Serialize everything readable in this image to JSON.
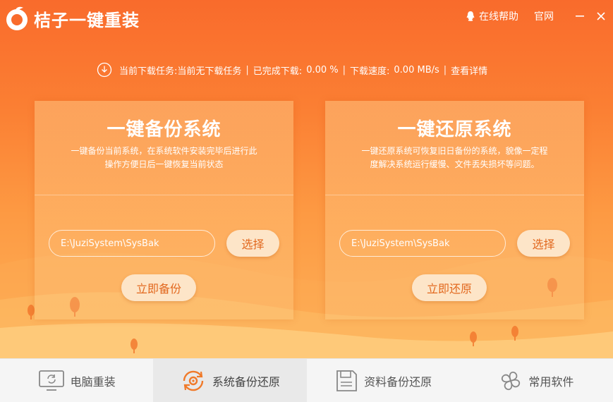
{
  "app": {
    "title": "桔子一键重装",
    "help_label": "在线帮助",
    "site_label": "官网",
    "minimize_icon": "minimize-icon",
    "close_icon": "close-icon"
  },
  "download": {
    "task_label": "当前下载任务:",
    "task_value": "当前无下载任务",
    "completed_label": "已完成下载:",
    "completed_value": "0.00 %",
    "speed_label": "下载速度:",
    "speed_value": "0.00 MB/s",
    "details_label": "查看详情",
    "icon": "download-icon"
  },
  "cards": {
    "backup": {
      "title": "一键备份系统",
      "description": "一键备份当前系统，在系统软件安装完毕后进行此操作方便日后一键恢复当前状态",
      "path": "E:\\JuziSystem\\SysBak",
      "select_label": "选择",
      "action_label": "立即备份"
    },
    "restore": {
      "title": "一键还原系统",
      "description": "一键还原系统可恢复旧日备份的系统，貌像一定程度解决系统运行缓慢、文件丢失损坏等问题。",
      "path": "E:\\JuziSystem\\SysBak",
      "select_label": "选择",
      "action_label": "立即还原"
    }
  },
  "nav": {
    "items": [
      {
        "label": "电脑重装",
        "icon": "monitor-refresh-icon",
        "active": false
      },
      {
        "label": "系统备份还原",
        "icon": "gear-sync-icon",
        "active": true
      },
      {
        "label": "资料备份还原",
        "icon": "save-disk-icon",
        "active": false
      },
      {
        "label": "常用软件",
        "icon": "fan-icon",
        "active": false
      }
    ]
  },
  "colors": {
    "brand_orange": "#f96b2c",
    "button_fill": "#fde5c8",
    "button_text": "#e2681e",
    "active_nav": "#e9e9e9"
  }
}
